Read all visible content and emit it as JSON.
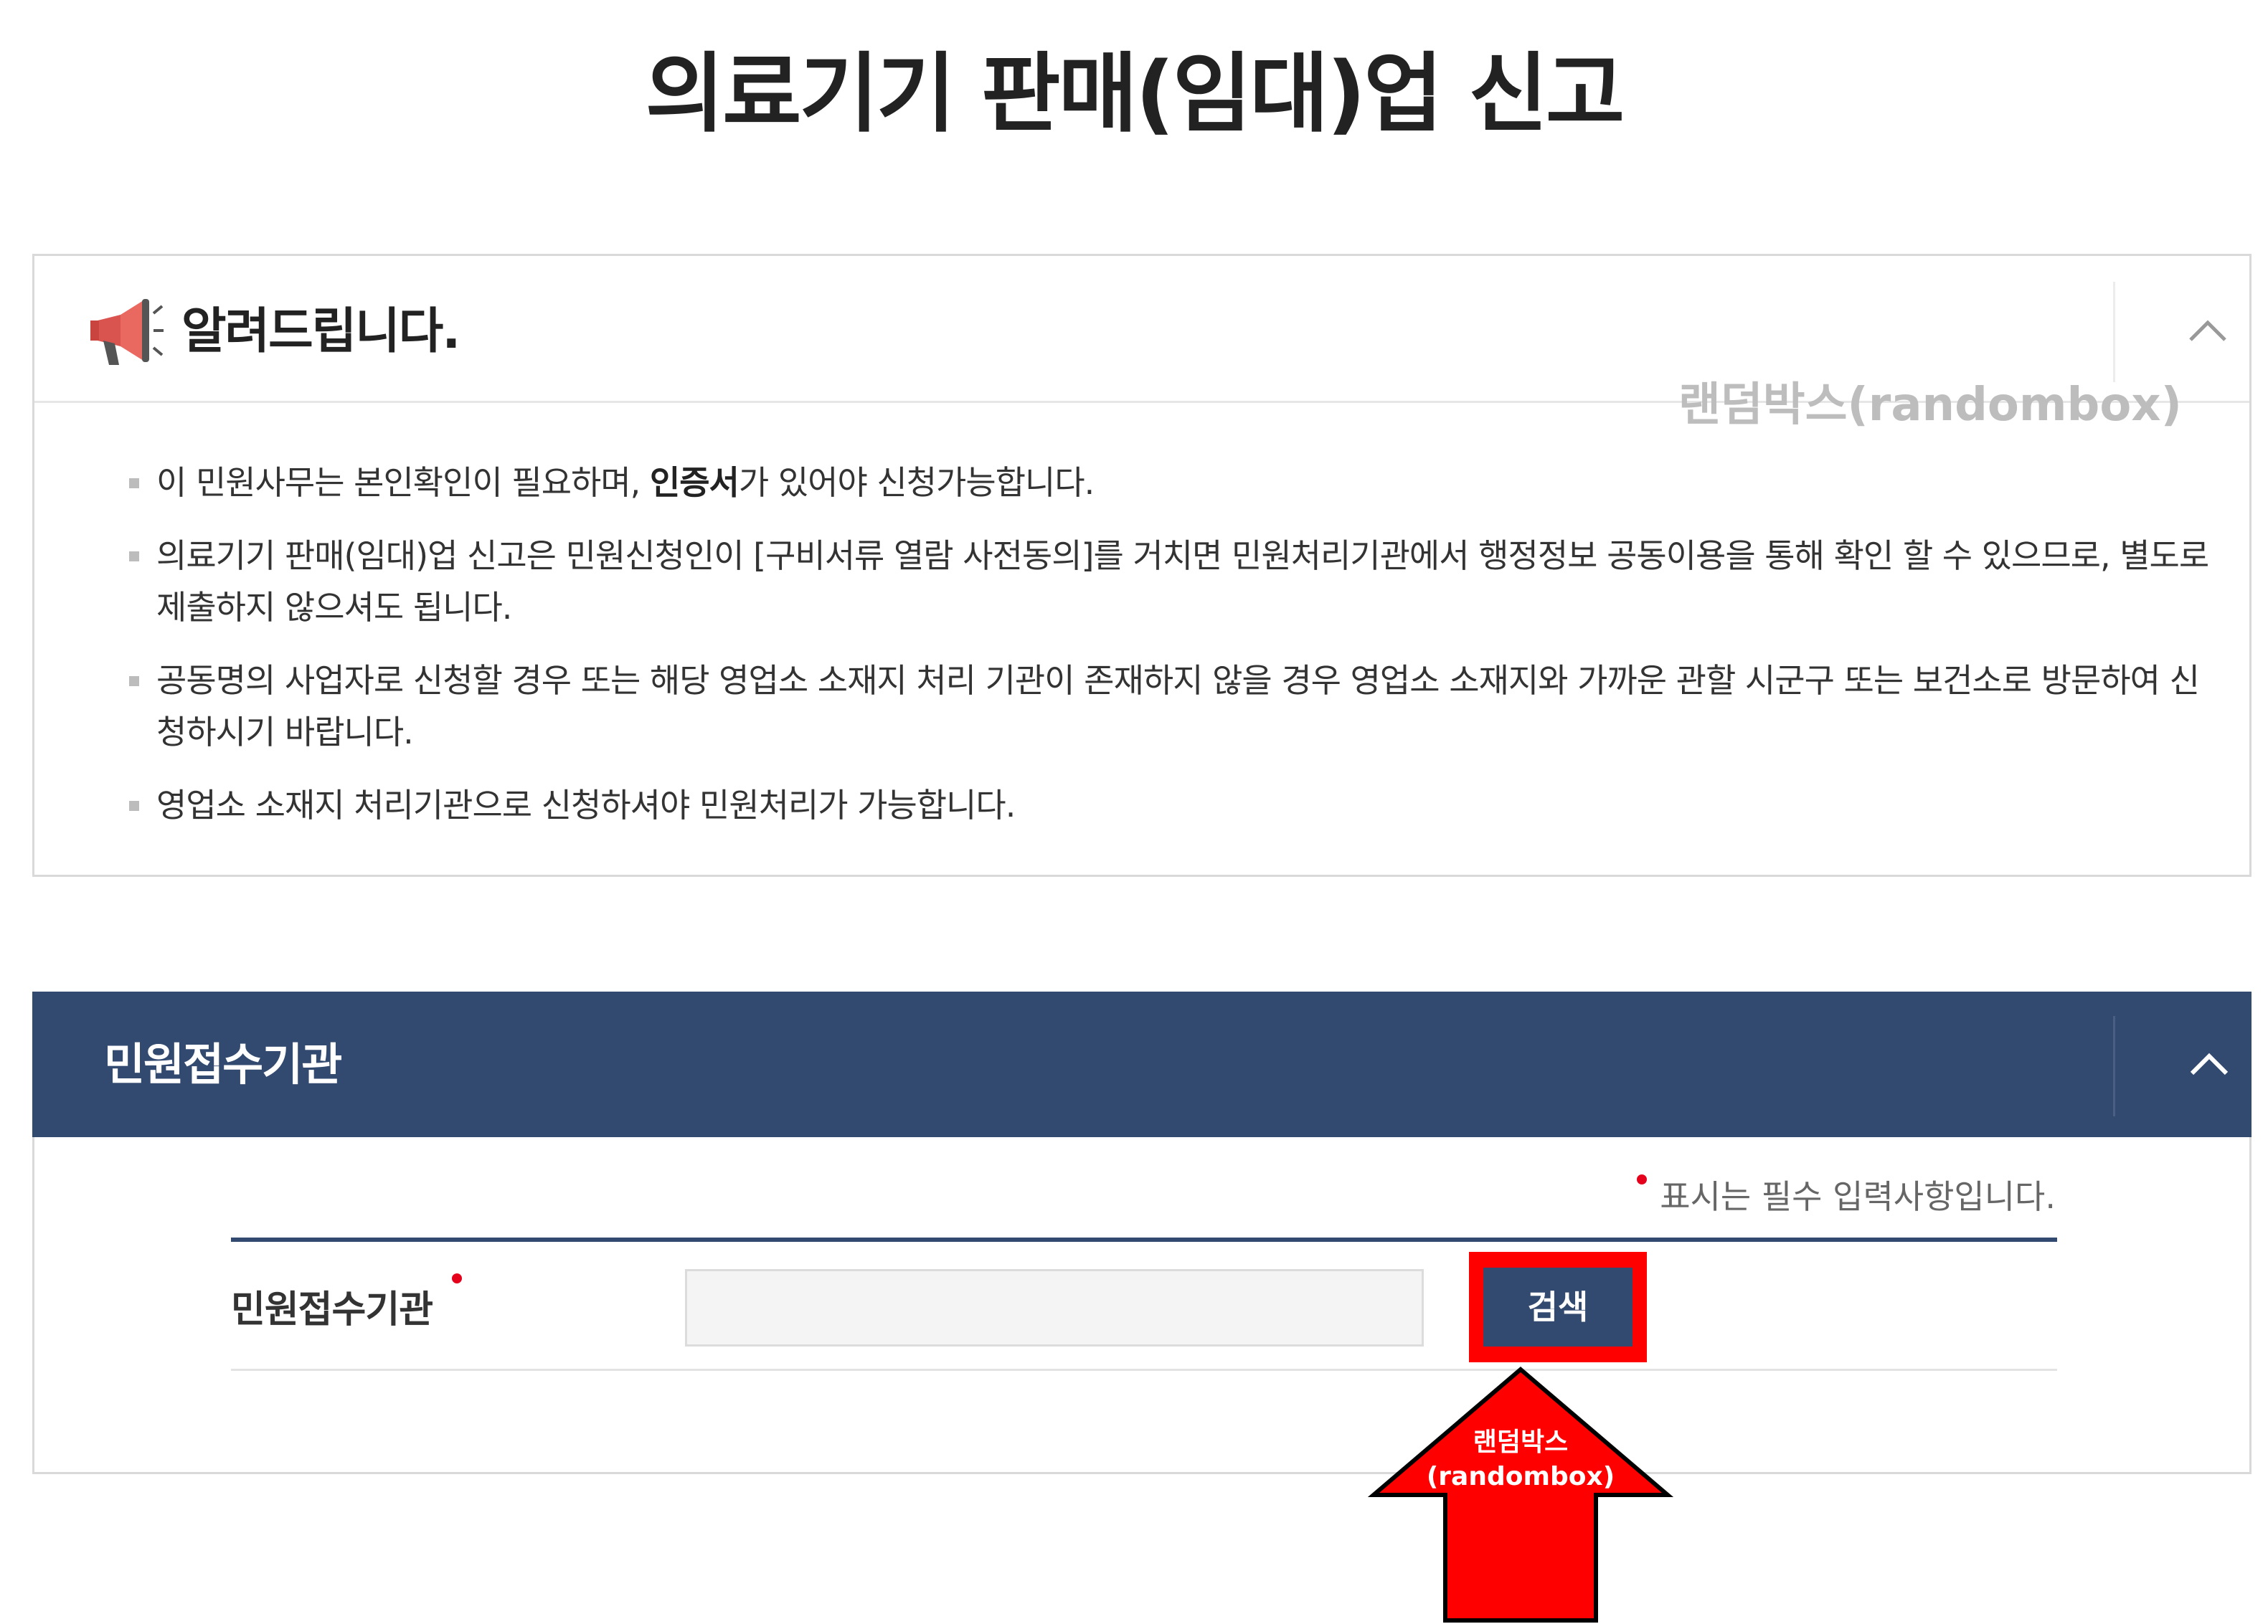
{
  "page": {
    "title": "의료기기 판매(임대)업 신고"
  },
  "notice": {
    "title": "알려드립니다.",
    "items": [
      {
        "before": "이 민원사무는 본인확인이 필요하며, ",
        "bold": "인증서",
        "after": "가 있어야 신청가능합니다."
      },
      {
        "before": "의료기기 판매(임대)업 신고은 민원신청인이 [구비서류 열람 사전동의]를 거치면 민원처리기관에서 행정정보 공동이용을 통해 확인 할 수 있으므로, 별도로 제출하지 않으셔도 됩니다.",
        "bold": "",
        "after": ""
      },
      {
        "before": "공동명의 사업자로 신청할 경우 또는 해당 영업소 소재지 처리 기관이 존재하지 않을 경우 영업소 소재지와 가까운 관할 시군구 또는 보건소로 방문하여 신청하시기 바랍니다.",
        "bold": "",
        "after": ""
      },
      {
        "before": "영업소 소재지 처리기관으로 신청하셔야 민원처리가 가능합니다.",
        "bold": "",
        "after": ""
      }
    ]
  },
  "watermark": "랜덤박스(randombox)",
  "reception": {
    "title": "민원접수기관",
    "required_note": "표시는 필수 입력사항입니다.",
    "field_label": "민원접수기관",
    "input_value": "",
    "search_label": "검색"
  },
  "annotation": {
    "line1": "랜덤박스",
    "line2": "(randombox)"
  },
  "colors": {
    "header_navy": "#334a70",
    "required_red": "#e5001c",
    "highlight_red": "#ff0000"
  },
  "icons": {
    "notice": "megaphone-icon",
    "toggle": "chevron-up-icon"
  }
}
